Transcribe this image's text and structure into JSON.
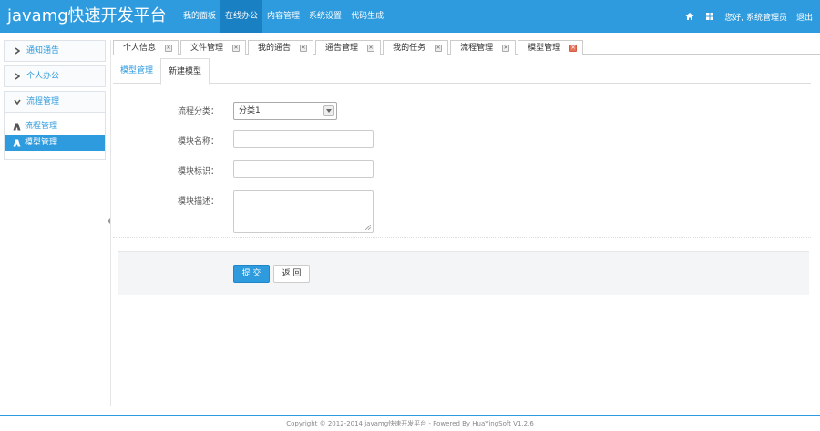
{
  "header": {
    "brand": "javamg快速开发平台",
    "nav": [
      "我的面板",
      "在线办公",
      "内容管理",
      "系统设置",
      "代码生成"
    ],
    "active_nav": 1,
    "greeting": "您好, 系统管理员",
    "logout": "退出"
  },
  "sidebar": {
    "groups": [
      {
        "label": "通知通告"
      },
      {
        "label": "个人办公"
      },
      {
        "label": "流程管理"
      }
    ],
    "sub_items": [
      {
        "label": "流程管理"
      },
      {
        "label": "模型管理"
      }
    ]
  },
  "tabs": [
    {
      "label": "个人信息"
    },
    {
      "label": "文件管理"
    },
    {
      "label": "我的通告"
    },
    {
      "label": "通告管理"
    },
    {
      "label": "我的任务"
    },
    {
      "label": "流程管理"
    },
    {
      "label": "模型管理"
    }
  ],
  "subtabs": [
    "模型管理",
    "新建模型"
  ],
  "form": {
    "category_label": "流程分类：",
    "category_value": "分类1",
    "name_label": "模块名称：",
    "key_label": "模块标识：",
    "desc_label": "模块描述：",
    "submit": "提 交",
    "back": "返 回"
  },
  "footer": {
    "copyright": "Copyright © 2012-2014 javamg快速开发平台 - Powered By HuaYingSoft V1.2.6"
  },
  "colors": {
    "primary": "#2e9bde",
    "nav_active": "#1a80c4",
    "tab_close_active": "#e8725b"
  }
}
